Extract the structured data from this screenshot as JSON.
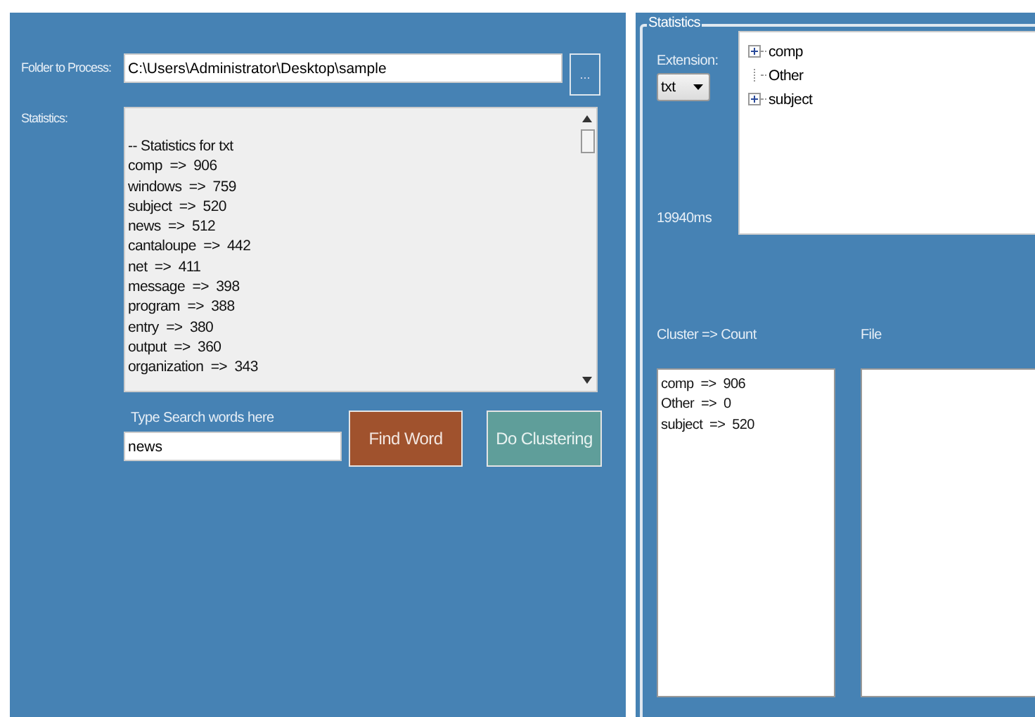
{
  "folder": {
    "label": "Folder to Process:",
    "value": "C:\\Users\\Administrator\\Desktop\\sample",
    "browse_button": "..."
  },
  "statistics": {
    "label": "Statistics:",
    "lines": [
      "-- Statistics for txt",
      "comp  =>  906",
      "windows  =>  759",
      "subject  =>  520",
      "news  =>  512",
      "cantaloupe  =>  442",
      "net  =>  411",
      "message  =>  398",
      "program  =>  388",
      "entry  =>  380",
      "output  =>  360",
      "organization  =>  343"
    ]
  },
  "search": {
    "label": "Type Search words here",
    "value": "news"
  },
  "buttons": [
    {
      "kind": "find",
      "label": "Find Word"
    },
    {
      "kind": "cluster",
      "label": "Do Clustering"
    }
  ],
  "group": {
    "title": "Statistics",
    "extension_label": "Extension:",
    "extension_value": "txt",
    "timing": "19940ms",
    "tree": [
      {
        "label": "comp",
        "expandable": true
      },
      {
        "label": "Other",
        "expandable": false
      },
      {
        "label": "subject",
        "expandable": true
      }
    ]
  },
  "cluster_list": {
    "label": "Cluster => Count",
    "items": [
      "comp  =>  906",
      "Other  =>  0",
      "subject  =>  520"
    ]
  },
  "file_list": {
    "label": "File"
  }
}
